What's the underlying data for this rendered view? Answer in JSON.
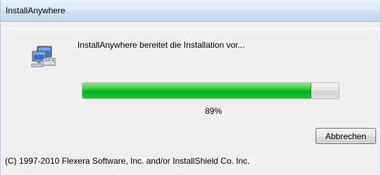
{
  "window": {
    "title": "InstallAnywhere"
  },
  "content": {
    "status_message": "InstallAnywhere bereitet die Installation vor...",
    "icon": "computer-setup-icon",
    "progress": {
      "percent": 89,
      "label": "89%"
    },
    "cancel_label": "Abbrechen",
    "copyright": "(C) 1997-2010 Flexera Software, Inc. and/or InstallShield Co. Inc."
  },
  "colors": {
    "progress_fill": "#06b025",
    "titlebar": "#cfe0f2",
    "background": "#f0f0f0"
  }
}
